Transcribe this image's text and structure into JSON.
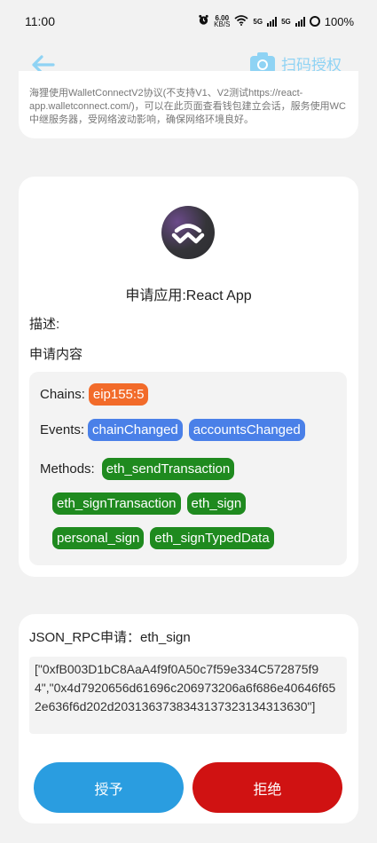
{
  "status_bar": {
    "time": "11:00",
    "speed_value": "6.00",
    "speed_unit": "KB/S",
    "sim1": "5G",
    "sim2": "5G",
    "battery": "100%"
  },
  "header": {
    "scan_label": "扫码授权"
  },
  "notice": {
    "text": "海狸使用WalletConnectV2协议(不支持V1、V2测试https://react-app.walletconnect.com/)，可以在此页面查看钱包建立会话，服务使用WC中继服务器，受网络波动影响，确保网络环境良好。"
  },
  "request": {
    "app_name": "申请应用:React App",
    "description_label": "描述:",
    "content_label": "申请内容",
    "chains_label": "Chains:",
    "chains": [
      "eip155:5"
    ],
    "events_label": "Events:",
    "events": [
      "chainChanged",
      "accountsChanged"
    ],
    "methods_label": "Methods:",
    "methods": [
      "eth_sendTransaction",
      "eth_signTransaction",
      "eth_sign",
      "personal_sign",
      "eth_signTypedData"
    ]
  },
  "rpc": {
    "title": "JSON_RPC申请：eth_sign",
    "payload": "[\"0xfB003D1bC8AaA4f9f0A50c7f59e334C572875f94\",\"0x4d7920656d61696c206973206a6f686e40646f652e636f6d202d2031363738343137323134313630\"]"
  },
  "actions": {
    "approve_label": "授予",
    "reject_label": "拒绝"
  },
  "colors": {
    "approve": "#2a9de0",
    "reject": "#d01212",
    "chain_chip": "#f26b2a",
    "event_chip": "#4a80e8",
    "method_chip": "#1f8a1f",
    "header_accent": "#8fd3f4"
  }
}
